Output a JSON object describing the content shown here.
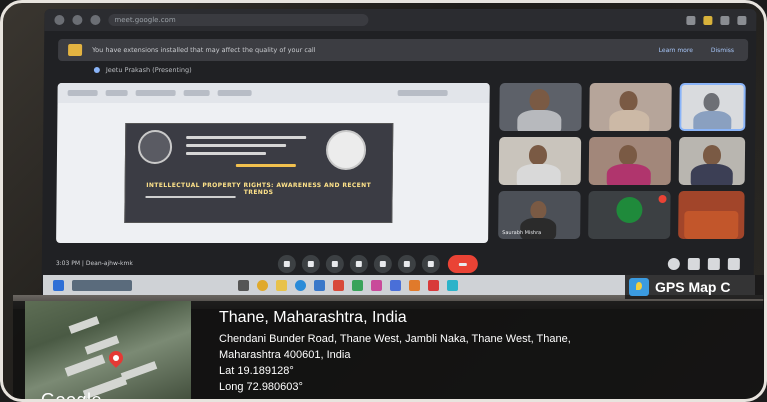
{
  "browser": {
    "url": "meet.google.com"
  },
  "notice": {
    "text": "You have extensions installed that may affect the quality of your call",
    "actions": [
      "Learn more",
      "Dismiss"
    ]
  },
  "presenter": {
    "label": "Jeetu Prakash (Presenting)"
  },
  "slide": {
    "heading": "INTELLECTUAL PROPERTY RIGHTS: AWARENESS AND RECENT TRENDS"
  },
  "participants": [
    {
      "name": "",
      "shirt": "#b7b9bd",
      "bg": "#7b8089"
    },
    {
      "name": "",
      "shirt": "#ccb9a6",
      "bg": "#b6a59a"
    },
    {
      "name": "",
      "shirt": "#8aa0c0",
      "bg": "#d9dbde"
    },
    {
      "name": "",
      "shirt": "#d9d9d9",
      "bg": "#c9c4bc"
    },
    {
      "name": "",
      "shirt": "#b0356d",
      "bg": "#a2877a"
    },
    {
      "name": "",
      "shirt": "#3c3f55",
      "bg": "#b9b6b0"
    },
    {
      "name": "Saurabh Mishra",
      "shirt": "#2b2b2b",
      "bg": "#4c5057"
    },
    {
      "name": "",
      "shirt": "",
      "bg": "#3c4043"
    },
    {
      "name": "",
      "shirt": "#c2562b",
      "bg": "#a2452a"
    }
  ],
  "meeting": {
    "time_label": "3:03 PM | Dean-ajhw-kmk"
  },
  "gps": {
    "badge": "GPS Map C",
    "title": "Thane, Maharashtra, India",
    "address_line1": "Chendani Bunder Road, Thane West, Jambli Naka, Thane West, Thane,",
    "address_line2": "Maharashtra 400601, India",
    "lat": "Lat 19.189128°",
    "long": "Long 72.980603°",
    "map_brand": "Google"
  },
  "colors": {
    "meet_bg": "#202124",
    "end_call": "#ea4335",
    "overlay": "#0f0f0f"
  }
}
